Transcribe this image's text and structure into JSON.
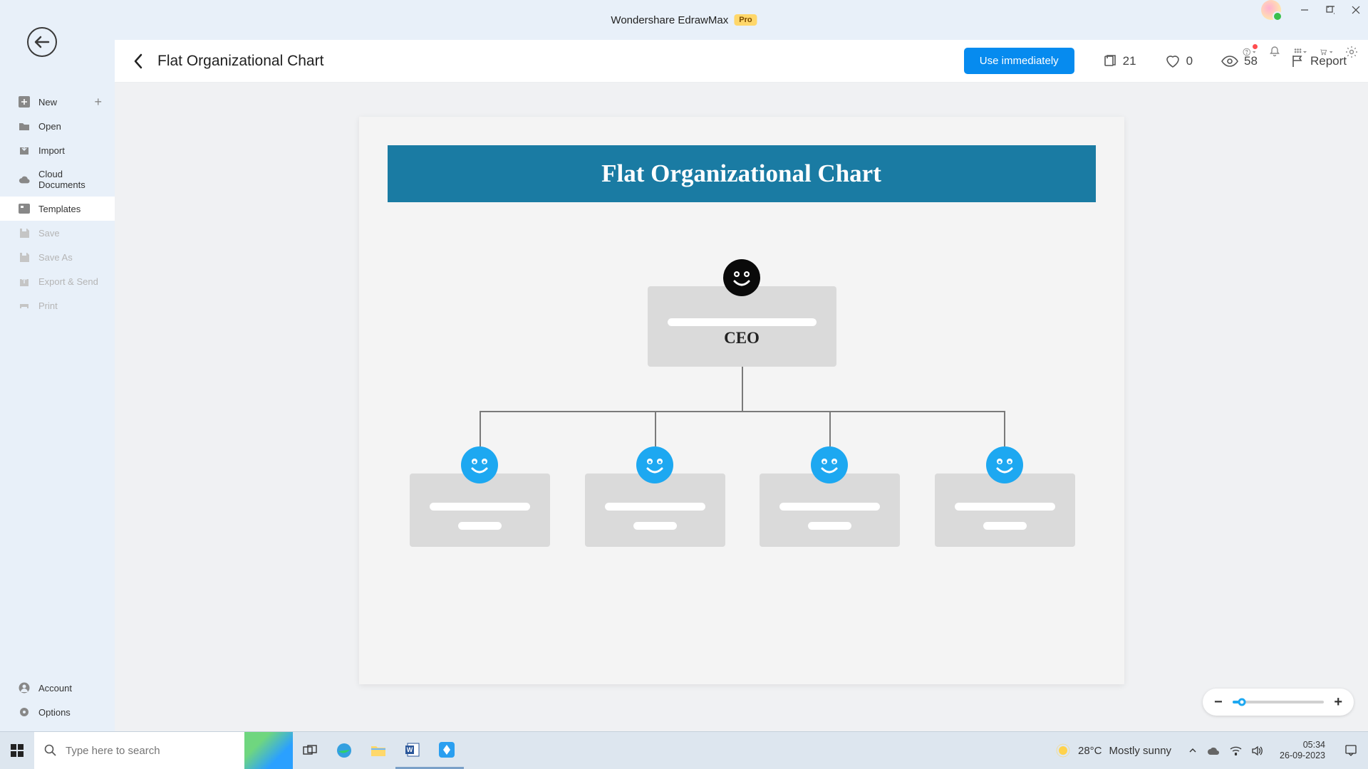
{
  "titlebar": {
    "app_name": "Wondershare EdrawMax",
    "pro_badge": "Pro"
  },
  "sidebar": {
    "new": "New",
    "open": "Open",
    "import": "Import",
    "cloud": "Cloud Documents",
    "templates": "Templates",
    "save": "Save",
    "save_as": "Save As",
    "export": "Export & Send",
    "print": "Print",
    "account": "Account",
    "options": "Options"
  },
  "header": {
    "title": "Flat Organizational Chart",
    "use_btn": "Use immediately",
    "copies": "21",
    "likes": "0",
    "views": "58",
    "report": "Report"
  },
  "chart_data": {
    "type": "diagram",
    "title": "Flat Organizational Chart",
    "nodes": {
      "root": {
        "role": "CEO",
        "avatar_color": "#000000",
        "name": ""
      },
      "children": [
        {
          "role": "",
          "name": "",
          "avatar_color": "#1da8f1"
        },
        {
          "role": "",
          "name": "",
          "avatar_color": "#1da8f1"
        },
        {
          "role": "",
          "name": "",
          "avatar_color": "#1da8f1"
        },
        {
          "role": "",
          "name": "",
          "avatar_color": "#1da8f1"
        }
      ]
    }
  },
  "zoom": {
    "minus": "−",
    "plus": "+"
  },
  "taskbar": {
    "search_placeholder": "Type here to search",
    "weather_temp": "28°C",
    "weather_desc": "Mostly sunny",
    "time": "05:34",
    "date": "26-09-2023"
  }
}
